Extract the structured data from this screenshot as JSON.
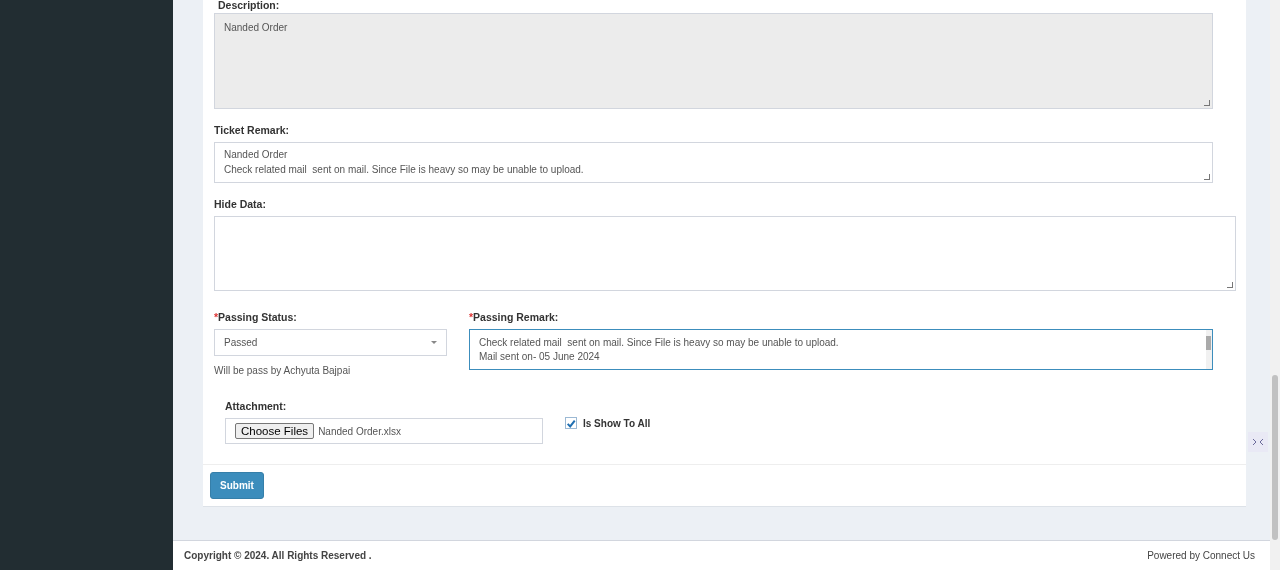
{
  "description": {
    "label": "Description:",
    "value": "Nanded Order",
    "disabled": true
  },
  "ticket_remark": {
    "label": "Ticket Remark:",
    "lines": [
      "Nanded Order",
      "Check related mail  sent on mail. Since File is heavy so may be unable to upload."
    ]
  },
  "hide_data": {
    "label": "Hide Data:"
  },
  "passing_status": {
    "label": "Passing Status:",
    "required_mark": "*",
    "value": "Passed",
    "note": "Will be pass by Achyuta Bajpai"
  },
  "passing_remark": {
    "label": "Passing Remark:",
    "required_mark": "*",
    "lines": [
      "Check related mail  sent on mail. Since File is heavy so may be unable to upload.",
      "Mail sent on- 05 June 2024"
    ]
  },
  "attachment": {
    "label": "Attachment:",
    "button": "Choose Files",
    "file_name": "Nanded Order.xlsx"
  },
  "show_to_all": {
    "label": "Is Show To All",
    "checked": true
  },
  "submit": "Submit",
  "footer": {
    "copyright": "Copyright © 2024. All Rights Reserved .",
    "powered_by": "Powered by Connect Us"
  }
}
